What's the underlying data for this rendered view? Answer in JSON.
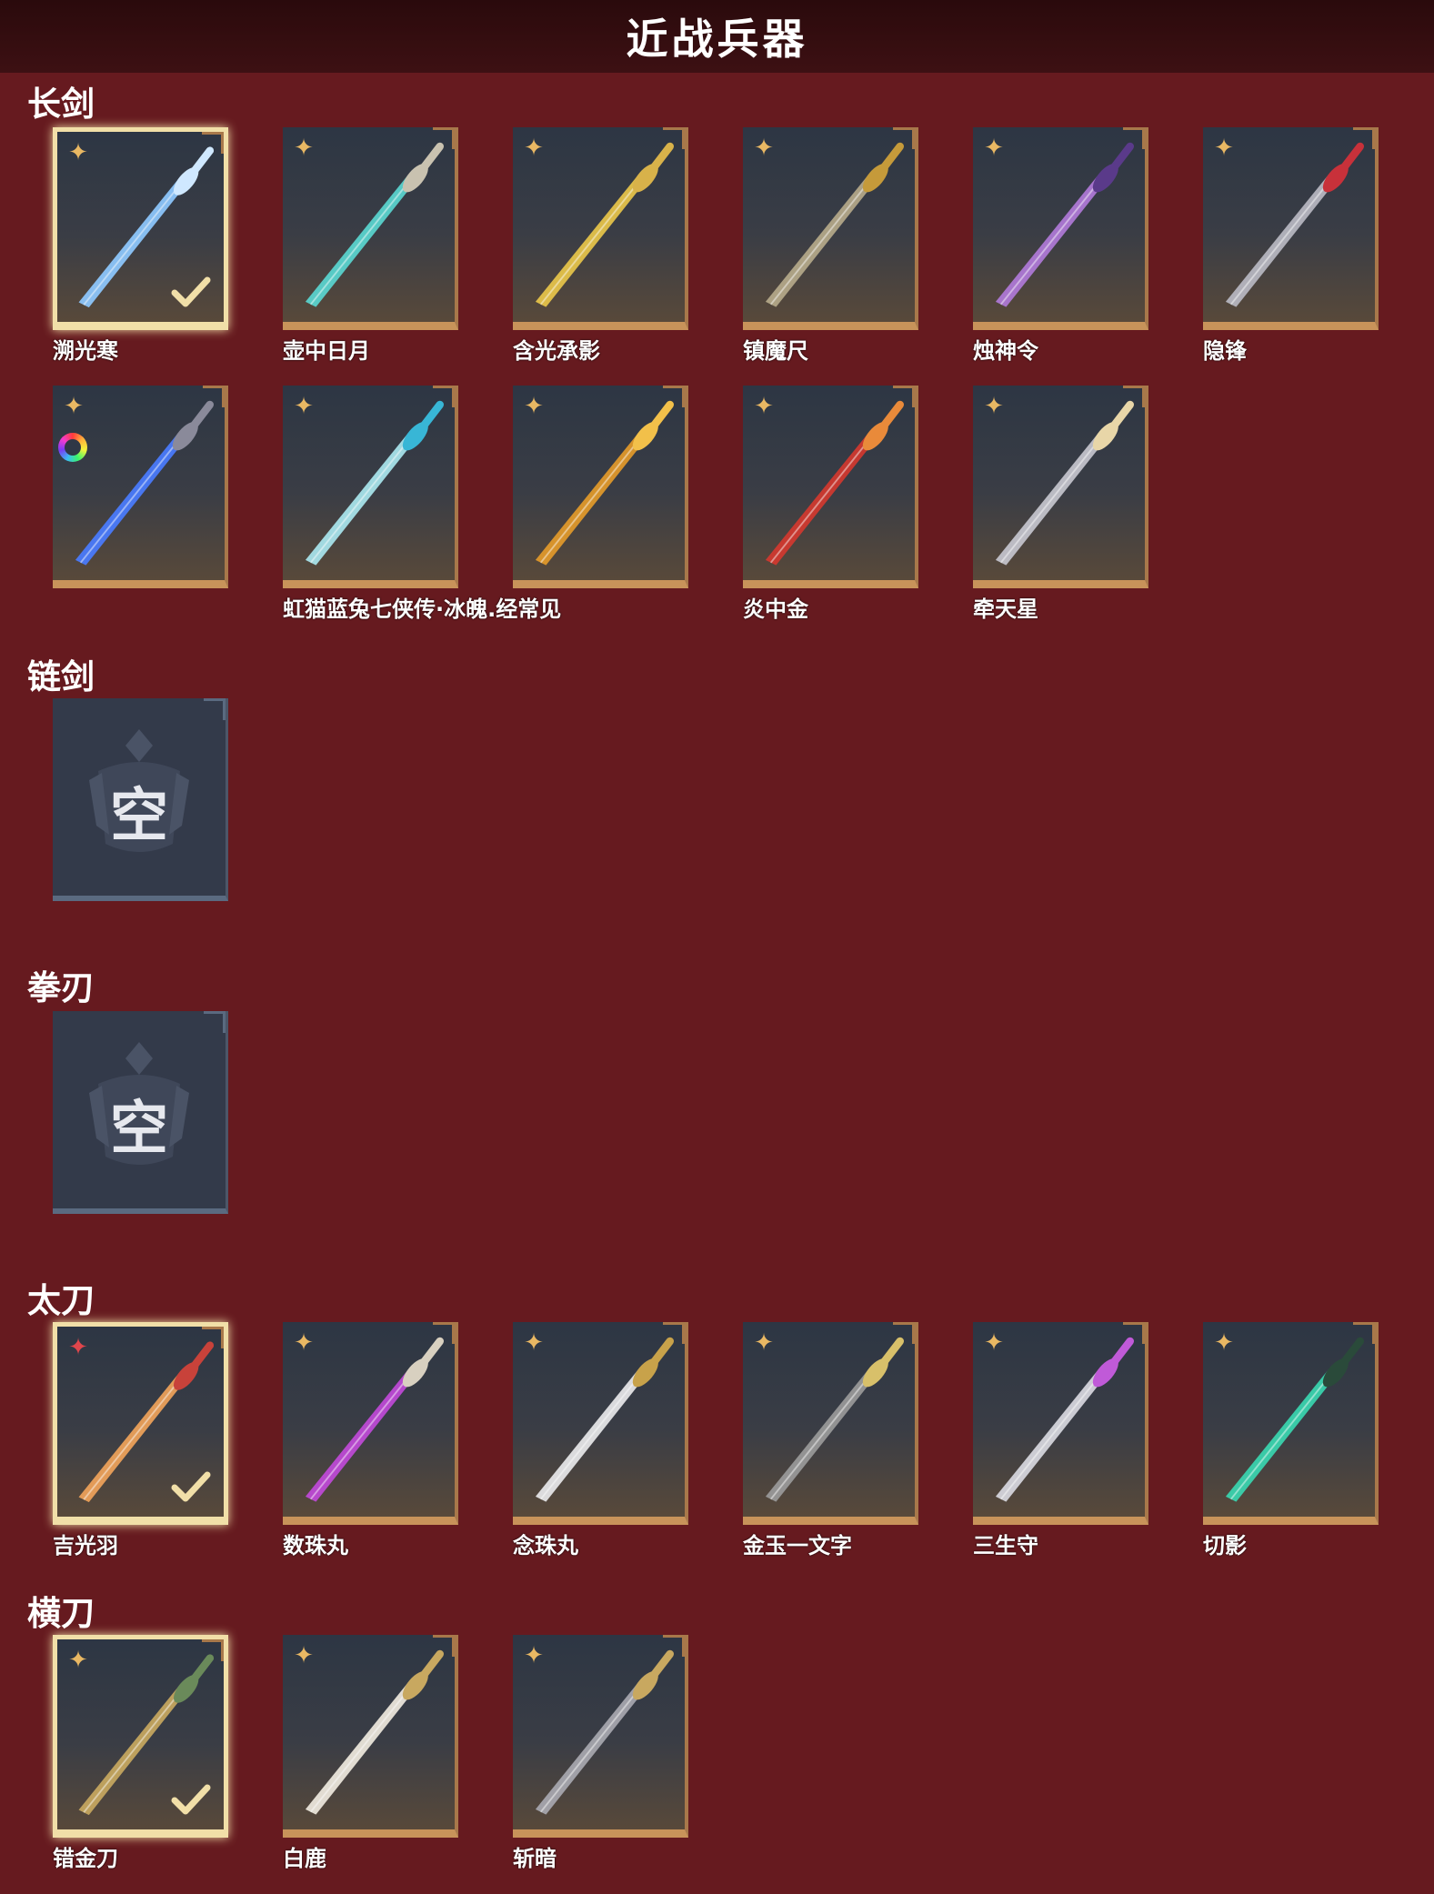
{
  "header": {
    "title": "近战兵器"
  },
  "icons": {
    "rarity": "shuriken-star-icon",
    "selected": "checkmark-icon",
    "rainbow": "rainbow-ring-icon"
  },
  "colors": {
    "background": "#661a1f",
    "gold": "#e9b863",
    "selected_border": "#f1dfa8",
    "empty_card": "#333a4a"
  },
  "empty_label": "空",
  "sections": [
    {
      "name": "长剑",
      "items": [
        {
          "name": "溯光寒",
          "selected": true,
          "blade": "#8ec9ff",
          "hilt": "#cfe8ff"
        },
        {
          "name": "壶中日月",
          "blade": "#5ad6d0",
          "hilt": "#c9c2b0"
        },
        {
          "name": "含光承影",
          "blade": "#e8c54a",
          "hilt": "#d8b24a"
        },
        {
          "name": "镇魔尺",
          "blade": "#b5a98a",
          "hilt": "#c59a3a"
        },
        {
          "name": "烛神令",
          "blade": "#b07ad8",
          "hilt": "#5a3a8a"
        },
        {
          "name": "隐锋",
          "blade": "#b8b8c2",
          "hilt": "#c8313a"
        },
        {
          "name": "",
          "rainbow": true,
          "blade": "#4a7cff",
          "hilt": "#8a8a9a"
        },
        {
          "name": "虹猫蓝兔七侠传·冰魄.经常见",
          "blade": "#a9e6ee",
          "hilt": "#38b6d6"
        },
        {
          "name": "",
          "blade": "#e39a2a",
          "hilt": "#f2c04a"
        },
        {
          "name": "炎中金",
          "blade": "#d2382f",
          "hilt": "#e98a3a"
        },
        {
          "name": "牵天星",
          "blade": "#c6c6ce",
          "hilt": "#e8d6a8"
        }
      ]
    },
    {
      "name": "链剑",
      "items": [
        {
          "name": "",
          "empty": true
        }
      ]
    },
    {
      "name": "拳刃",
      "items": [
        {
          "name": "",
          "empty": true
        }
      ]
    },
    {
      "name": "太刀",
      "items": [
        {
          "name": "吉光羽",
          "selected": true,
          "rarity": "red",
          "blade": "#f0a35a",
          "hilt": "#c8423a"
        },
        {
          "name": "数珠丸",
          "blade": "#c04ad8",
          "hilt": "#d8d0c0"
        },
        {
          "name": "念珠丸",
          "blade": "#e8e8ea",
          "hilt": "#c8a24a"
        },
        {
          "name": "金玉一文字",
          "blade": "#9a9a9a",
          "hilt": "#d8c06a"
        },
        {
          "name": "三生守",
          "blade": "#d8d8e0",
          "hilt": "#c05ad8"
        },
        {
          "name": "切影",
          "blade": "#3ad6b0",
          "hilt": "#2a4a3a"
        }
      ]
    },
    {
      "name": "横刀",
      "items": [
        {
          "name": "错金刀",
          "selected": true,
          "blade": "#c8a860",
          "hilt": "#6a8a5a"
        },
        {
          "name": "白鹿",
          "blade": "#efe9de",
          "hilt": "#c8a860"
        },
        {
          "name": "斩暗",
          "blade": "#a8a8b0",
          "hilt": "#c8a860"
        }
      ]
    }
  ]
}
